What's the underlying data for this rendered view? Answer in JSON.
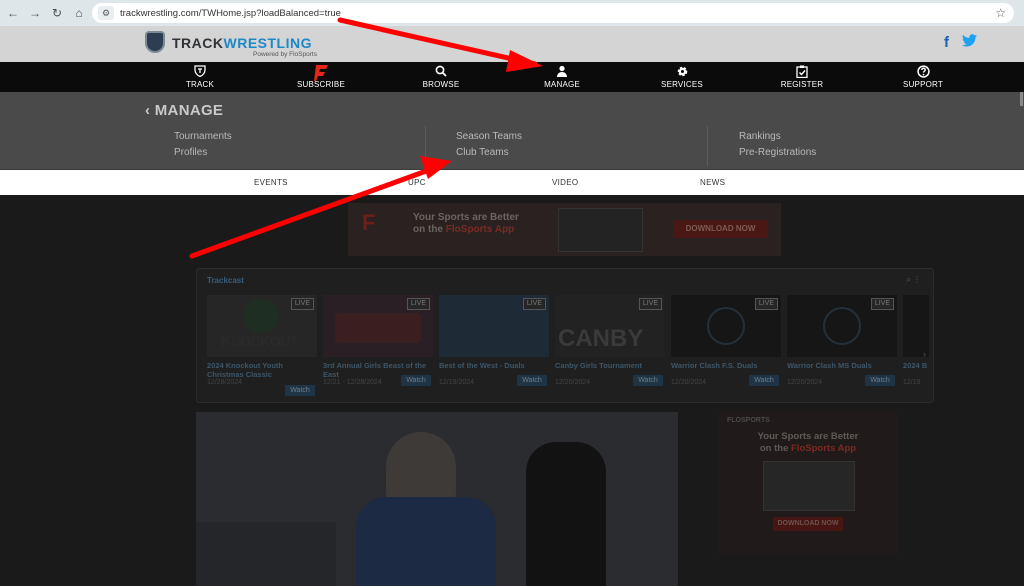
{
  "browser": {
    "url": "trackwrestling.com/TWHome.jsp?loadBalanced=true"
  },
  "header": {
    "logo_track": "TRACK",
    "logo_wrestling": "WRESTLING",
    "logo_sub": "Powered by FloSports",
    "facebook": "f",
    "twitter": "🐦"
  },
  "main_nav": [
    {
      "label": "TRACK",
      "icon": "tw-shield-icon"
    },
    {
      "label": "SUBSCRIBE",
      "icon": "flo-icon"
    },
    {
      "label": "BROWSE",
      "icon": "search-icon"
    },
    {
      "label": "MANAGE",
      "icon": "user-icon"
    },
    {
      "label": "SERVICES",
      "icon": "gear-icon"
    },
    {
      "label": "REGISTER",
      "icon": "clipboard-check-icon"
    },
    {
      "label": "SUPPORT",
      "icon": "question-icon"
    }
  ],
  "manage": {
    "title": "MANAGE",
    "col1": [
      "Tournaments",
      "Profiles"
    ],
    "col2": [
      "Season Teams",
      "Club Teams"
    ],
    "col3": [
      "Rankings",
      "Pre-Registrations"
    ]
  },
  "sub_nav": [
    "EVENTS",
    "UPC",
    "VIDEO",
    "NEWS"
  ],
  "banner_top": {
    "line1": "Your Sports are Better",
    "line2_a": "on the ",
    "line2_b": "FloSports App",
    "button": "DOWNLOAD NOW"
  },
  "trackcast": {
    "title": "Trackcast",
    "live_label": "LIVE",
    "watch_label": "Watch",
    "events": [
      {
        "name": "2024 Knockout Youth Christmas Classic",
        "date": "12/28/2024",
        "thumb": "KNOCKOUT"
      },
      {
        "name": "3rd Annual Girls Beast of the East",
        "date": "12/21 - 12/28/2024",
        "thumb": ""
      },
      {
        "name": "Best of the West - Duals",
        "date": "12/19/2024",
        "thumb": ""
      },
      {
        "name": "Canby Girls Tournament",
        "date": "12/20/2024",
        "thumb": "CANBY"
      },
      {
        "name": "Warrior Clash F.S. Duals",
        "date": "12/20/2024",
        "thumb": ""
      },
      {
        "name": "Warrior Clash MS Duals",
        "date": "12/20/2024",
        "thumb": ""
      },
      {
        "name": "2024 B",
        "date": "12/19",
        "thumb": ""
      }
    ]
  },
  "ad_right": {
    "brand": "FLOSPORTS",
    "line1": "Your Sports are Better",
    "line2_a": "on the ",
    "line2_b": "FloSports App",
    "button": "DOWNLOAD NOW"
  },
  "colors": {
    "accent_blue": "#1e88c7",
    "annotation_red": "#ff0000",
    "nav_bg": "#0b0b0b"
  }
}
